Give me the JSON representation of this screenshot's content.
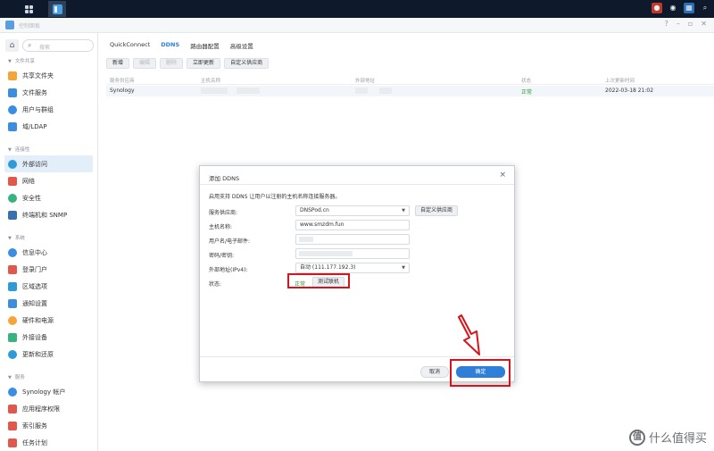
{
  "window": {
    "title": "控制面板"
  },
  "search": {
    "placeholder": "搜索"
  },
  "sidebar": {
    "sections": [
      {
        "label": "文件共享",
        "items": [
          {
            "label": "共享文件夹",
            "icon": "folder-share-icon",
            "color": "#f3a53a"
          },
          {
            "label": "文件服务",
            "icon": "file-services-icon",
            "color": "#3a8de0"
          },
          {
            "label": "用户与群组",
            "icon": "users-icon",
            "color": "#3a8de0"
          },
          {
            "label": "域/LDAP",
            "icon": "domain-icon",
            "color": "#3a8de0"
          }
        ]
      },
      {
        "label": "连接性",
        "items": [
          {
            "label": "外部访问",
            "icon": "external-access-icon",
            "color": "#2e9bd8",
            "selected": true
          },
          {
            "label": "网络",
            "icon": "network-icon",
            "color": "#e2574c"
          },
          {
            "label": "安全性",
            "icon": "security-icon",
            "color": "#36b37e"
          },
          {
            "label": "终端机和 SNMP",
            "icon": "terminal-icon",
            "color": "#3a6fb0"
          }
        ]
      },
      {
        "label": "系统",
        "items": [
          {
            "label": "信息中心",
            "icon": "info-center-icon",
            "color": "#3a8de0"
          },
          {
            "label": "登录门户",
            "icon": "login-portal-icon",
            "color": "#e2574c"
          },
          {
            "label": "区域选项",
            "icon": "region-icon",
            "color": "#2e9bd8"
          },
          {
            "label": "通知设置",
            "icon": "notification-icon",
            "color": "#3a8de0"
          },
          {
            "label": "硬件和电源",
            "icon": "hardware-power-icon",
            "color": "#f3a53a"
          },
          {
            "label": "外接设备",
            "icon": "external-devices-icon",
            "color": "#36b37e"
          },
          {
            "label": "更新和还原",
            "icon": "update-restore-icon",
            "color": "#2e9bd8"
          }
        ]
      },
      {
        "label": "服务",
        "items": [
          {
            "label": "Synology 帐户",
            "icon": "synology-account-icon",
            "color": "#3a8de0"
          },
          {
            "label": "应用程序权限",
            "icon": "app-privileges-icon",
            "color": "#e2574c"
          },
          {
            "label": "索引服务",
            "icon": "indexing-icon",
            "color": "#e2574c"
          },
          {
            "label": "任务计划",
            "icon": "task-scheduler-icon",
            "color": "#e2574c"
          }
        ]
      }
    ]
  },
  "tabs": [
    {
      "label": "QuickConnect",
      "active": false
    },
    {
      "label": "DDNS",
      "active": true
    },
    {
      "label": "路由器配置",
      "active": false
    },
    {
      "label": "高级设置",
      "active": false
    }
  ],
  "toolbar": {
    "add": "新增",
    "edit": "编辑",
    "delete": "删除",
    "update_now": "立即更新",
    "custom_provider": "自定义供应商"
  },
  "table": {
    "columns": [
      "服务供应商",
      "主机名称",
      "外部地址",
      "状态",
      "上次更新时间"
    ],
    "rows": [
      {
        "provider": "Synology",
        "status": "正常",
        "last_update": "2022-03-18 21:02"
      }
    ]
  },
  "dialog": {
    "title": "添加 DDNS",
    "description": "启用支持 DDNS 让用户以注册的主机名称连接服务器。",
    "labels": {
      "provider": "服务供应商:",
      "hostname": "主机名称:",
      "username": "用户名/电子邮件:",
      "password": "密码/密钥:",
      "external_ip": "外部地址(IPv4):",
      "status": "状态:"
    },
    "values": {
      "provider": "DNSPod.cn",
      "hostname": "www.smzdm.fun",
      "external_ip": "自动 (111.177.192.3)",
      "status": "正常"
    },
    "custom_provider_button": "自定义供应商",
    "test_button": "测试联机",
    "cancel": "取消",
    "ok": "确定"
  },
  "watermark": {
    "logo": "值",
    "text": "什么值得买"
  }
}
